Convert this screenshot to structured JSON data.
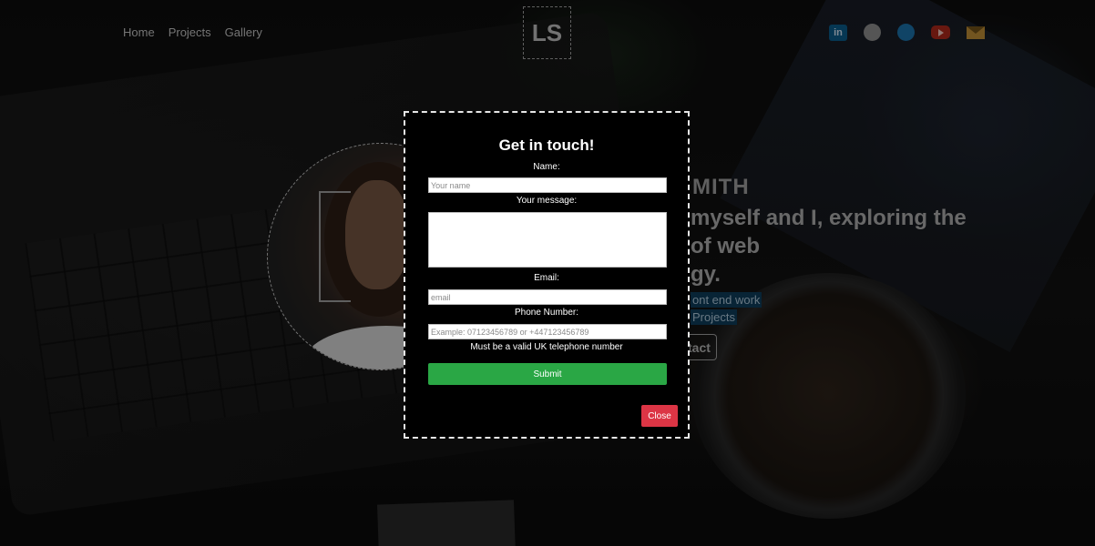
{
  "nav": {
    "links": [
      "Home",
      "Projects",
      "Gallery"
    ],
    "logo": "LS"
  },
  "social": {
    "icons": [
      "linkedin-icon",
      "github-icon",
      "twitter-icon",
      "youtube-icon",
      "mail-icon"
    ],
    "linkedin_text": "in"
  },
  "hero": {
    "name": "MITH",
    "line1": "myself and I, exploring the",
    "line2": "of web",
    "line3": "gy.",
    "tag1": "ont end work",
    "tag2": "Projects",
    "contact": "tact"
  },
  "modal": {
    "title": "Get in touch!",
    "name_label": "Name:",
    "name_placeholder": "Your name",
    "message_label": "Your message:",
    "email_label": "Email:",
    "email_placeholder": "email",
    "phone_label": "Phone Number:",
    "phone_placeholder": "Example: 07123456789 or +447123456789",
    "phone_hint": "Must be a valid UK telephone number",
    "submit": "Submit",
    "close": "Close"
  },
  "colors": {
    "submit": "#2aa745",
    "close": "#dc3545",
    "tag_bg": "#0e3a57"
  }
}
